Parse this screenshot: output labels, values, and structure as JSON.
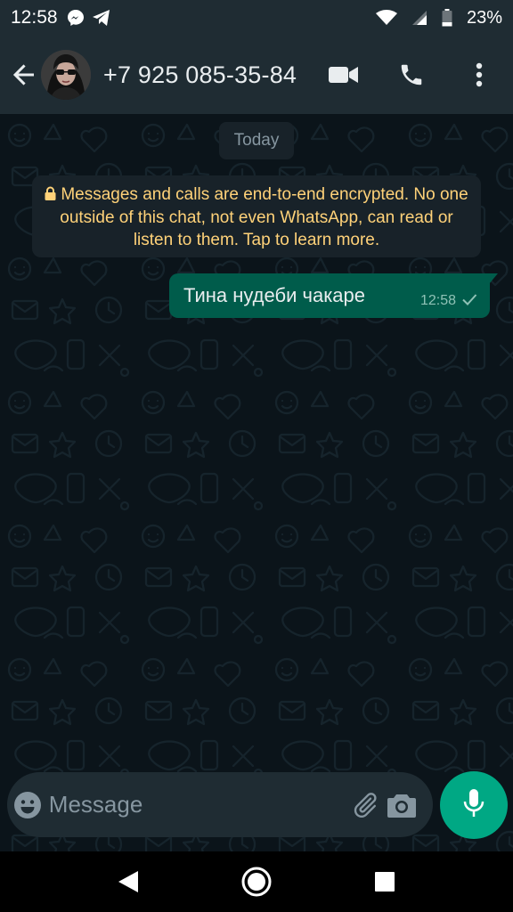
{
  "status_bar": {
    "time": "12:58",
    "battery_percent": "23%",
    "icons": [
      "messenger-icon",
      "telegram-icon",
      "wifi-icon",
      "signal-icon",
      "battery-icon"
    ]
  },
  "header": {
    "contact_name": "+7 925 085-35-84",
    "icons": [
      "back-arrow-icon",
      "video-call-icon",
      "voice-call-icon",
      "more-vertical-icon"
    ]
  },
  "chat": {
    "date_label": "Today",
    "encryption_notice": "Messages and calls are end-to-end encrypted. No one outside of this chat, not even WhatsApp, can read or listen to them. Tap to learn more.",
    "messages": [
      {
        "text": "Тина нудеби чакаре",
        "time": "12:58",
        "direction": "outgoing",
        "status": "sent"
      }
    ]
  },
  "composer": {
    "placeholder": "Message",
    "value": "",
    "icons": [
      "emoji-icon",
      "paperclip-icon",
      "camera-icon",
      "mic-icon"
    ]
  },
  "colors": {
    "header_bg": "#1f2c33",
    "chat_bg": "#0b141a",
    "outgoing_bubble": "#005c4b",
    "accent": "#00a884",
    "notice_text": "#ffd279"
  }
}
